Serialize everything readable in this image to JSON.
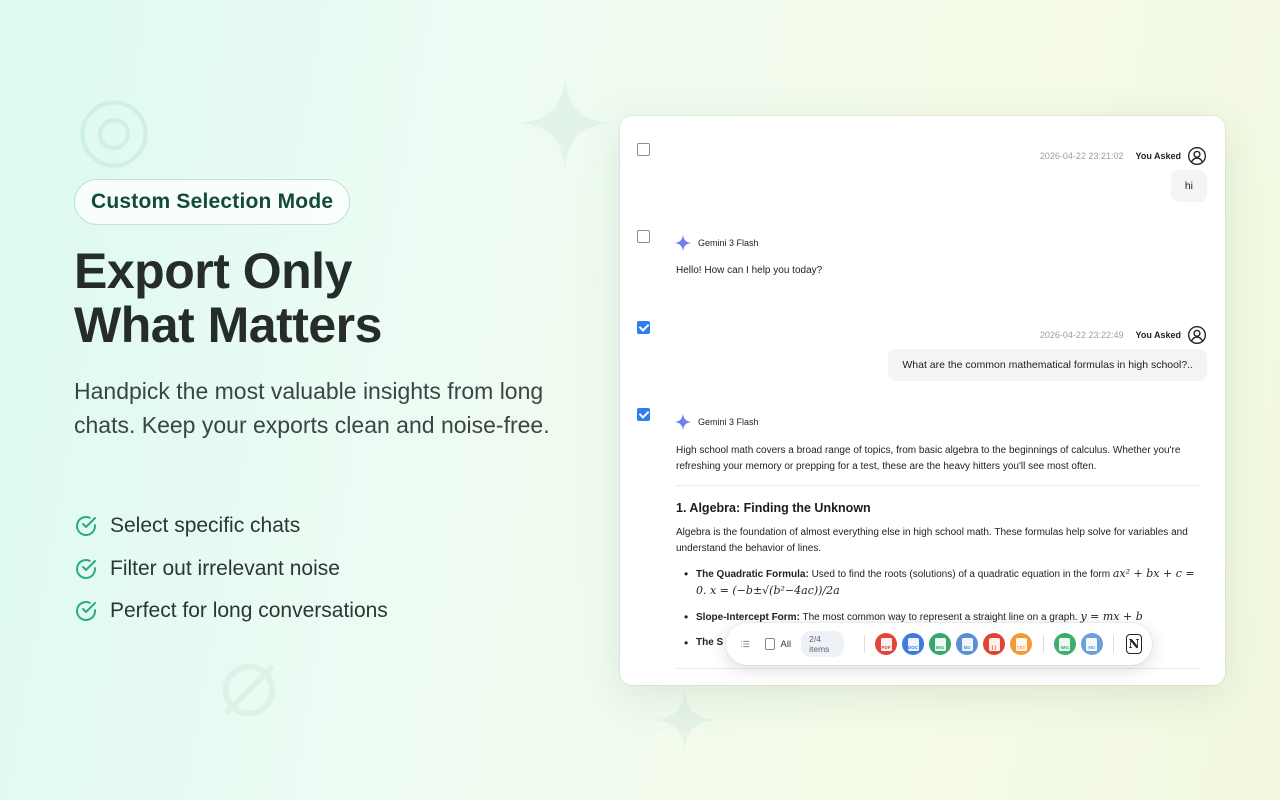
{
  "hero": {
    "badge": "Custom Selection Mode",
    "headline_line1": "Export Only",
    "headline_line2": "What Matters",
    "description": "Handpick the most valuable insights from long chats. Keep your exports clean and noise-free.",
    "features": [
      "Select specific chats",
      "Filter out irrelevant noise",
      "Perfect for long conversations"
    ]
  },
  "colors": {
    "accent_green": "#2bab7c",
    "checkbox_blue": "#2f7ef0"
  },
  "chat": {
    "messages": [
      {
        "role": "user",
        "checked": false,
        "timestamp": "2026-04-22 23:21:02",
        "who": "You Asked",
        "text": "hi"
      },
      {
        "role": "model",
        "checked": false,
        "model": "Gemini 3 Flash",
        "text": "Hello! How can I help you today?"
      },
      {
        "role": "user",
        "checked": true,
        "timestamp": "2026-04-22 23:22:49",
        "who": "You Asked",
        "text": "What are the common mathematical formulas in high school?.."
      },
      {
        "role": "model",
        "checked": true,
        "model": "Gemini 3 Flash",
        "intro": "High school math covers a broad range of topics, from basic algebra to the beginnings of calculus. Whether you're refreshing your memory or prepping for a test, these are the heavy hitters you'll see most often.",
        "section_title": "1. Algebra: Finding the Unknown",
        "section_text": "Algebra is the foundation of almost everything else in high school math. These formulas help solve for variables and understand the behavior of lines.",
        "bullets": [
          {
            "label": "The Quadratic Formula:",
            "text": "Used to find the roots (solutions) of a quadratic equation in the form"
          },
          {
            "label": "Slope-Intercept Form:",
            "text": "The most common way to represent a straight line on a graph."
          },
          {
            "label": "The S",
            "text": ""
          }
        ]
      }
    ]
  },
  "toolbar": {
    "all_label": "All",
    "count_label": "2/4 items",
    "formats": [
      {
        "icon": "pdf-icon",
        "label": "PDF",
        "color": "#e0463c"
      },
      {
        "icon": "docx-icon",
        "label": "DOC",
        "color": "#3d7be0"
      },
      {
        "icon": "image-icon",
        "label": "IMG",
        "color": "#36a86a"
      },
      {
        "icon": "markdown-icon",
        "label": "MD",
        "color": "#5a8fd6"
      },
      {
        "icon": "json-icon",
        "label": "{ }",
        "color": "#e2432f"
      },
      {
        "icon": "txt-icon",
        "label": "TXT",
        "color": "#f29a35"
      },
      {
        "icon": "sheet-icon",
        "label": "IMG",
        "color": "#3cae6e"
      },
      {
        "icon": "md-alt-icon",
        "label": "MD",
        "color": "#6d9fd8"
      }
    ],
    "notion_label": "N"
  }
}
